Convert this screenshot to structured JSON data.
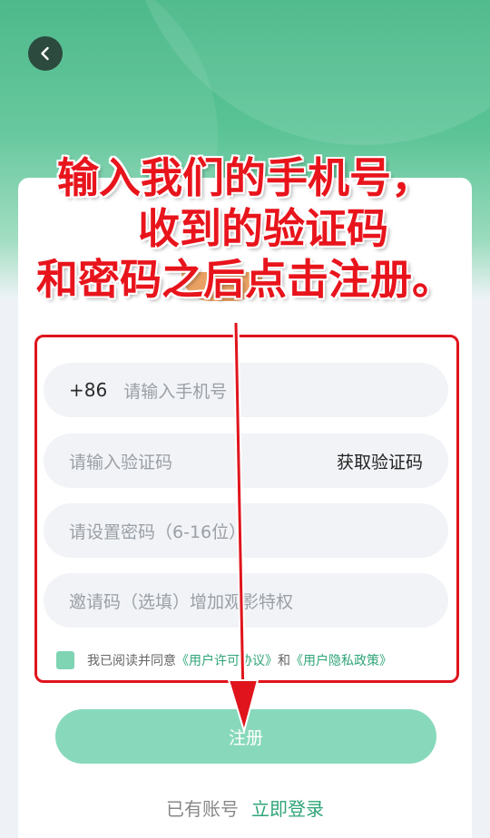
{
  "header": {
    "back_icon": "chevron-left-icon"
  },
  "instruction": {
    "line1": "输入我们的手机号，",
    "line2": "收到的验证码",
    "line3": "和密码之后点击注册。"
  },
  "form": {
    "phone": {
      "country_code": "+86",
      "placeholder": "请输入手机号"
    },
    "verify": {
      "placeholder": "请输入验证码",
      "get_code_label": "获取验证码"
    },
    "password": {
      "placeholder": "请设置密码（6-16位）"
    },
    "invite": {
      "placeholder": "邀请码（选填）增加观影特权"
    }
  },
  "agreement": {
    "prefix": "我已阅读并同意",
    "user_license": "《用户许可协议》",
    "and": "和",
    "privacy": "《用户隐私政策》"
  },
  "register_button": "注册",
  "login": {
    "prompt": "已有账号",
    "link": "立即登录"
  },
  "colors": {
    "accent": "#2fa577",
    "annotation_red": "#e0141c",
    "button": "#88d9bb"
  }
}
